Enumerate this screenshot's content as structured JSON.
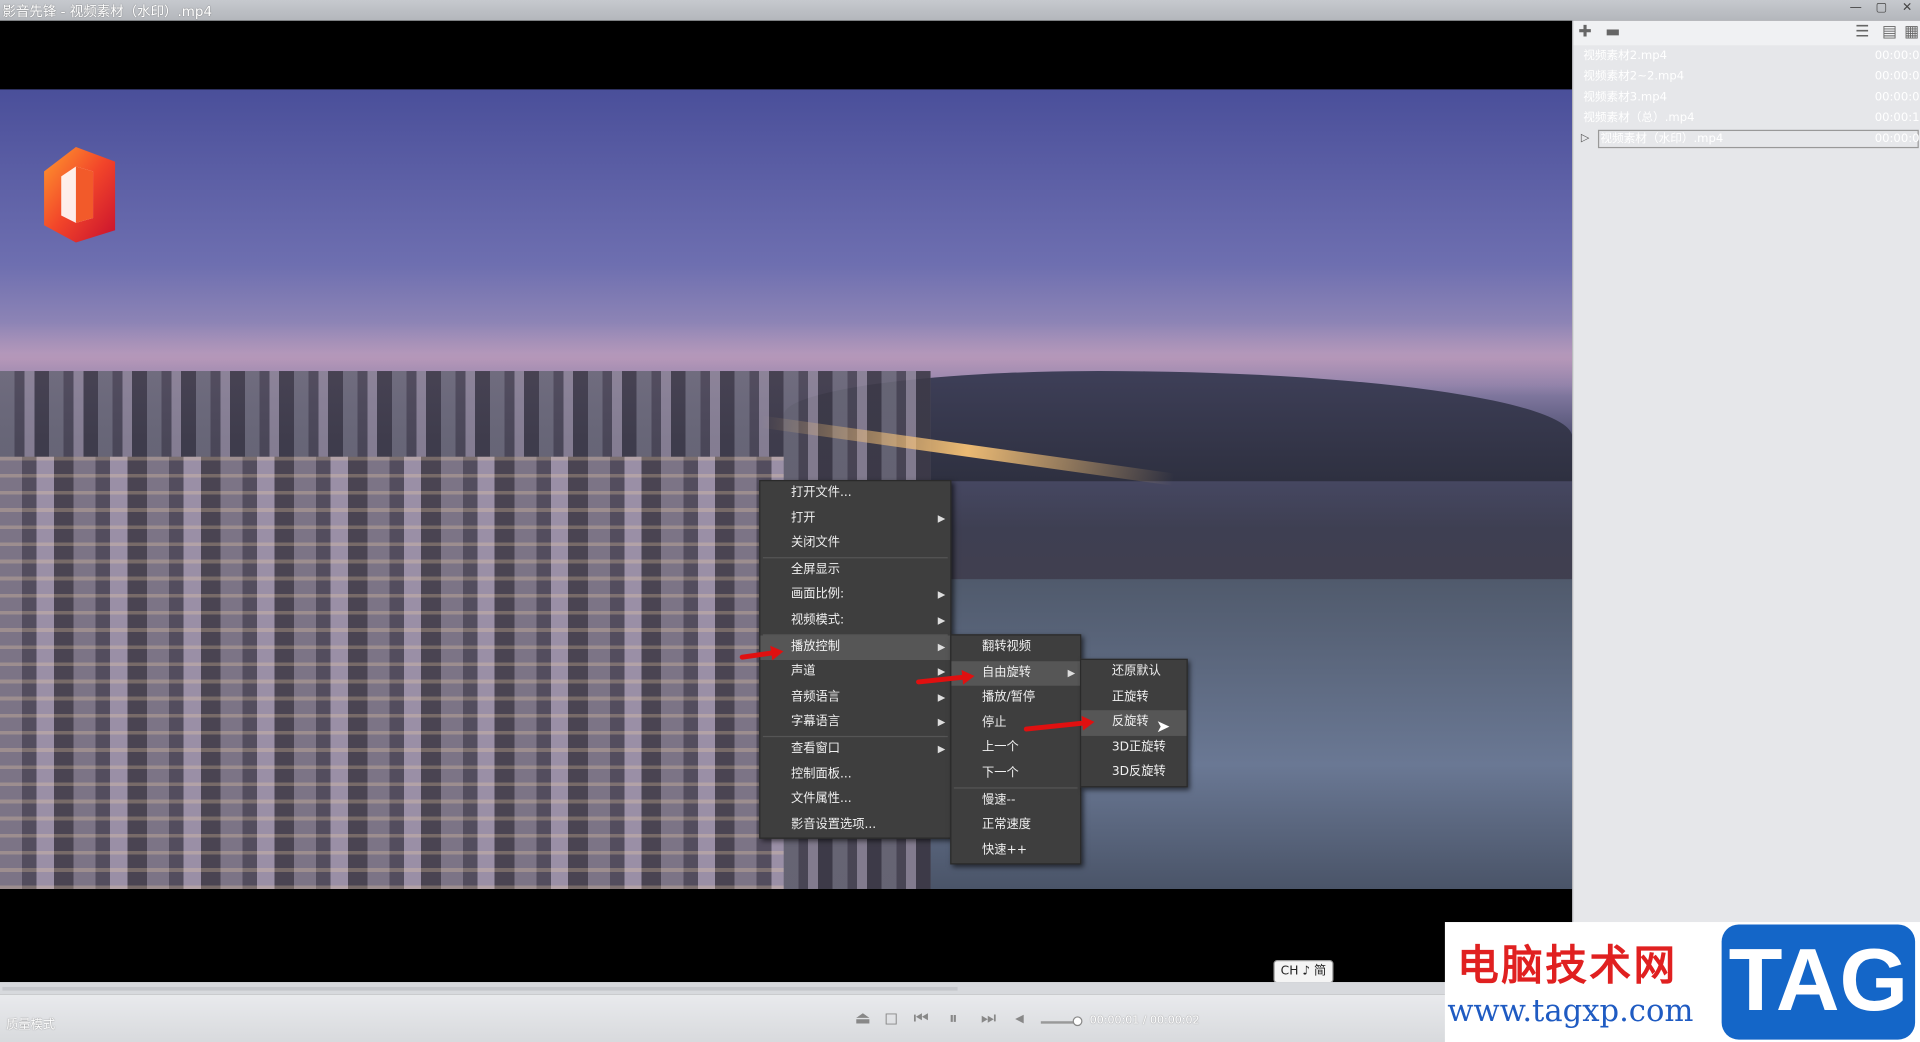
{
  "window": {
    "title": "影音先锋 - 视频素材（水印）.mp4"
  },
  "ime": {
    "label": "CH ♪ 简"
  },
  "playlist": [
    {
      "name": "视频素材2.mp4",
      "time": "00:00:0"
    },
    {
      "name": "视频素材2~2.mp4",
      "time": "00:00:0"
    },
    {
      "name": "视频素材3.mp4",
      "time": "00:00:0"
    },
    {
      "name": "视频素材（总）.mp4",
      "time": "00:00:1"
    },
    {
      "name": "视频素材（水印）.mp4",
      "time": "00:00:0"
    }
  ],
  "status": {
    "quality_mode": "质量模式",
    "timecode": "00:00:01 / 00:00:02"
  },
  "context_menu": {
    "items": [
      "打开文件...",
      "打开",
      "关闭文件",
      "全屏显示",
      "画面比例:",
      "视频模式:",
      "播放控制",
      "声道",
      "音频语言",
      "字幕语言",
      "查看窗口",
      "控制面板...",
      "文件属性...",
      "影音设置选项..."
    ]
  },
  "playback_menu": {
    "items": [
      "翻转视频",
      "自由旋转",
      "播放/暂停",
      "停止",
      "上一个",
      "下一个",
      "慢速--",
      "正常速度",
      "快速++"
    ]
  },
  "rotate_menu": {
    "items": [
      "还原默认",
      "正旋转",
      "反旋转",
      "3D正旋转",
      "3D反旋转"
    ]
  },
  "watermark": {
    "title": "电脑技术网",
    "url": "www.tagxp.com",
    "tag": "TAG"
  },
  "colors": {
    "menu_bg": "#3e3e3e",
    "annotation_arrow": "#e01010",
    "watermark_blue": "#1466c8",
    "watermark_red": "#e02020"
  }
}
